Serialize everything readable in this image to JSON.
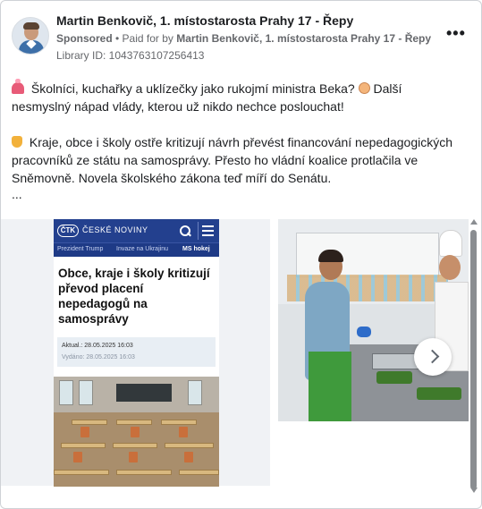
{
  "post": {
    "author": "Martin Benkovič, 1. místostarosta Prahy 17 - Řepy",
    "sponsored": "Sponsored",
    "paid_for_prefix": "• Paid for by",
    "paid_for_by": "Martin Benkovič, 1. místostarosta Prahy 17 - Řepy",
    "library_id": "Library ID: 1043763107256413",
    "more_icon": "more-horizontal-icon",
    "paragraph1": "Školníci, kuchařky a uklízečky jako rukojmí ministra Beka?",
    "paragraph1_tail": "Další nesmyslný nápad vlády, kterou už nikdo nechce poslouchat!",
    "paragraph2": "Kraje, obce i školy ostře kritizují návrh převést financování nepedagogických pracovníků ze státu na samosprávy. Přesto ho vládní koalice protlačila ve Sněmovně. Novela školského zákona teď míří do Senátu.",
    "ellipsis": "..."
  },
  "article": {
    "brand_logo": "ČTK",
    "brand_title": "ČESKÉ NOVINY",
    "nav": [
      "Prezident Trump",
      "Invaze na Ukrajinu",
      "MS hokej"
    ],
    "title": "Obce, kraje i školy kritizují převod placení nepedagogů na samosprávy",
    "updated": "Aktual.: 28.05.2025 16:03",
    "published": "Vydáno: 28.05.2025 16:03"
  },
  "carousel": {
    "next_icon": "chevron-right-icon"
  },
  "colors": {
    "ctk_blue": "#23408e",
    "meta_gray": "#65676b"
  }
}
